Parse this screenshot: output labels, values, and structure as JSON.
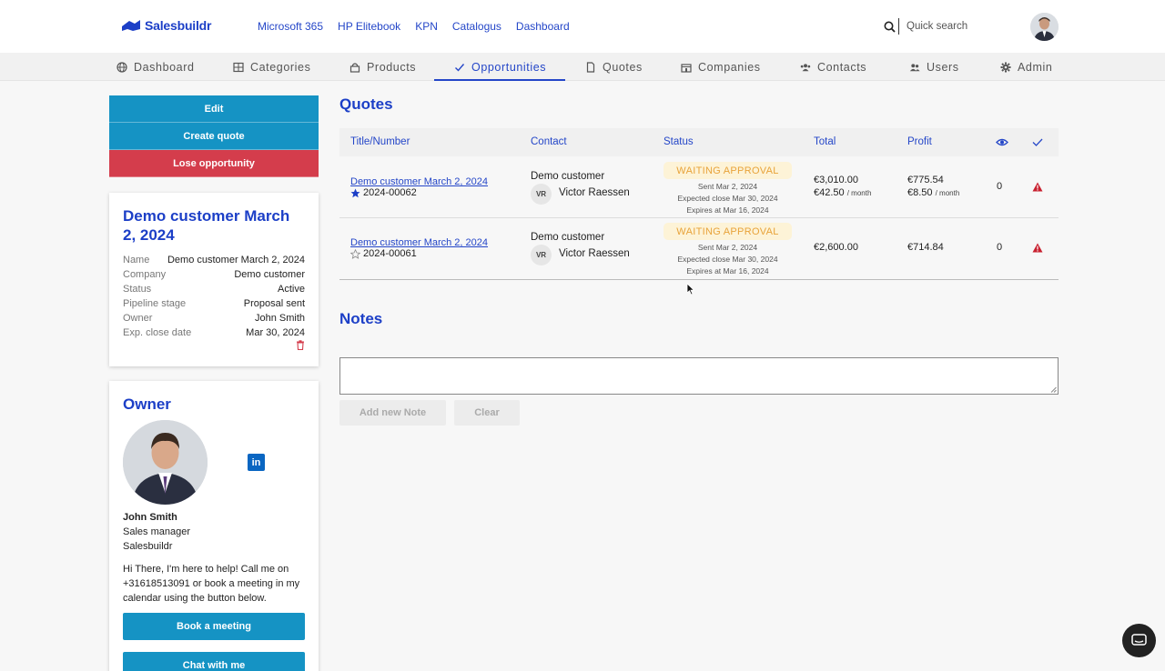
{
  "brand": {
    "name": "Salesbuildr",
    "color": "#1c3fc7"
  },
  "top_links": [
    "Microsoft 365",
    "HP Elitebook",
    "KPN",
    "Catalogus",
    "Dashboard"
  ],
  "search": {
    "placeholder": "Quick search",
    "icon": "search-icon"
  },
  "nav": {
    "active": "Opportunities",
    "items": [
      {
        "label": "Dashboard",
        "icon": "globe-icon"
      },
      {
        "label": "Categories",
        "icon": "grid-icon"
      },
      {
        "label": "Products",
        "icon": "lock-icon"
      },
      {
        "label": "Opportunities",
        "icon": "check-icon"
      },
      {
        "label": "Quotes",
        "icon": "document-icon"
      },
      {
        "label": "Companies",
        "icon": "building-icon"
      },
      {
        "label": "Contacts",
        "icon": "contacts-icon"
      },
      {
        "label": "Users",
        "icon": "users-icon"
      },
      {
        "label": "Admin",
        "icon": "gear-icon"
      }
    ]
  },
  "actions": {
    "edit": "Edit",
    "create_quote": "Create quote",
    "lose": "Lose opportunity"
  },
  "opportunity": {
    "title": "Demo customer March 2, 2024",
    "fields": [
      {
        "label": "Name",
        "value": "Demo customer March 2, 2024"
      },
      {
        "label": "Company",
        "value": "Demo customer"
      },
      {
        "label": "Status",
        "value": "Active"
      },
      {
        "label": "Pipeline stage",
        "value": "Proposal sent"
      },
      {
        "label": "Owner",
        "value": "John Smith"
      },
      {
        "label": "Exp. close date",
        "value": "Mar 30, 2024"
      }
    ]
  },
  "owner": {
    "heading": "Owner",
    "name": "John Smith",
    "role": "Sales manager",
    "company": "Salesbuildr",
    "message": "Hi There, I'm here to help! Call me on +31618513091 or book a meeting in my calendar using the button below.",
    "book_label": "Book a meeting",
    "chat_label": "Chat with me"
  },
  "quotes": {
    "heading": "Quotes",
    "columns": {
      "title": "Title/Number",
      "contact": "Contact",
      "status": "Status",
      "total": "Total",
      "profit": "Profit"
    },
    "rows": [
      {
        "title": "Demo customer March 2, 2024",
        "number": "2024-00062",
        "starred": true,
        "company": "Demo customer",
        "contact_initials": "VR",
        "contact_name": "Victor Raessen",
        "status": "WAITING APPROVAL",
        "sent": "Sent Mar 2, 2024",
        "expected_close": "Expected close Mar 30, 2024",
        "expires": "Expires at Mar 16, 2024",
        "total": "€3,010.00",
        "total_monthly": "€42.50",
        "profit": "€775.54",
        "profit_monthly": "€8.50",
        "per_month": "/ month",
        "views": "0"
      },
      {
        "title": "Demo customer March 2, 2024",
        "number": "2024-00061",
        "starred": false,
        "company": "Demo customer",
        "contact_initials": "VR",
        "contact_name": "Victor Raessen",
        "status": "WAITING APPROVAL",
        "sent": "Sent Mar 2, 2024",
        "expected_close": "Expected close Mar 30, 2024",
        "expires": "Expires at Mar 16, 2024",
        "total": "€2,600.00",
        "profit": "€714.84",
        "views": "0"
      }
    ]
  },
  "notes": {
    "heading": "Notes",
    "add_label": "Add new Note",
    "clear_label": "Clear"
  },
  "colors": {
    "accent": "#2446c8",
    "button": "#1593c4",
    "danger": "#d43d4c",
    "badge_bg": "#fdf3d7",
    "badge_text": "#e8a33a"
  }
}
